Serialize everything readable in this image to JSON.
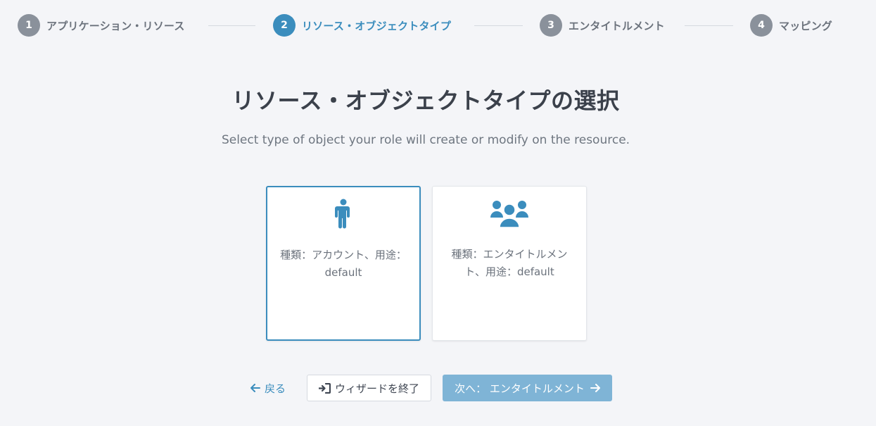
{
  "stepper": {
    "steps": [
      {
        "number": "1",
        "label": "アプリケーション・リソース",
        "active": false
      },
      {
        "number": "2",
        "label": "リソース・オブジェクトタイプ",
        "active": true
      },
      {
        "number": "3",
        "label": "エンタイトルメント",
        "active": false
      },
      {
        "number": "4",
        "label": "マッピング",
        "active": false
      }
    ]
  },
  "main": {
    "title": "リソース・オブジェクトタイプの選択",
    "subtitle": "Select type of object your role will create or modify on the resource."
  },
  "cards": [
    {
      "icon": "user-icon",
      "text": "種類：アカウント、用途：default",
      "selected": true
    },
    {
      "icon": "users-icon",
      "text": "種類：エンタイトルメント、用途：default",
      "selected": false
    }
  ],
  "footer": {
    "back_label": "戻る",
    "exit_label": "ウィザードを終了",
    "next_label": "次へ： エンタイトルメント"
  },
  "colors": {
    "accent": "#3b8dbd",
    "next_button": "#7fb4d6",
    "inactive_step": "#8a919b",
    "background": "#f4f5f8"
  }
}
